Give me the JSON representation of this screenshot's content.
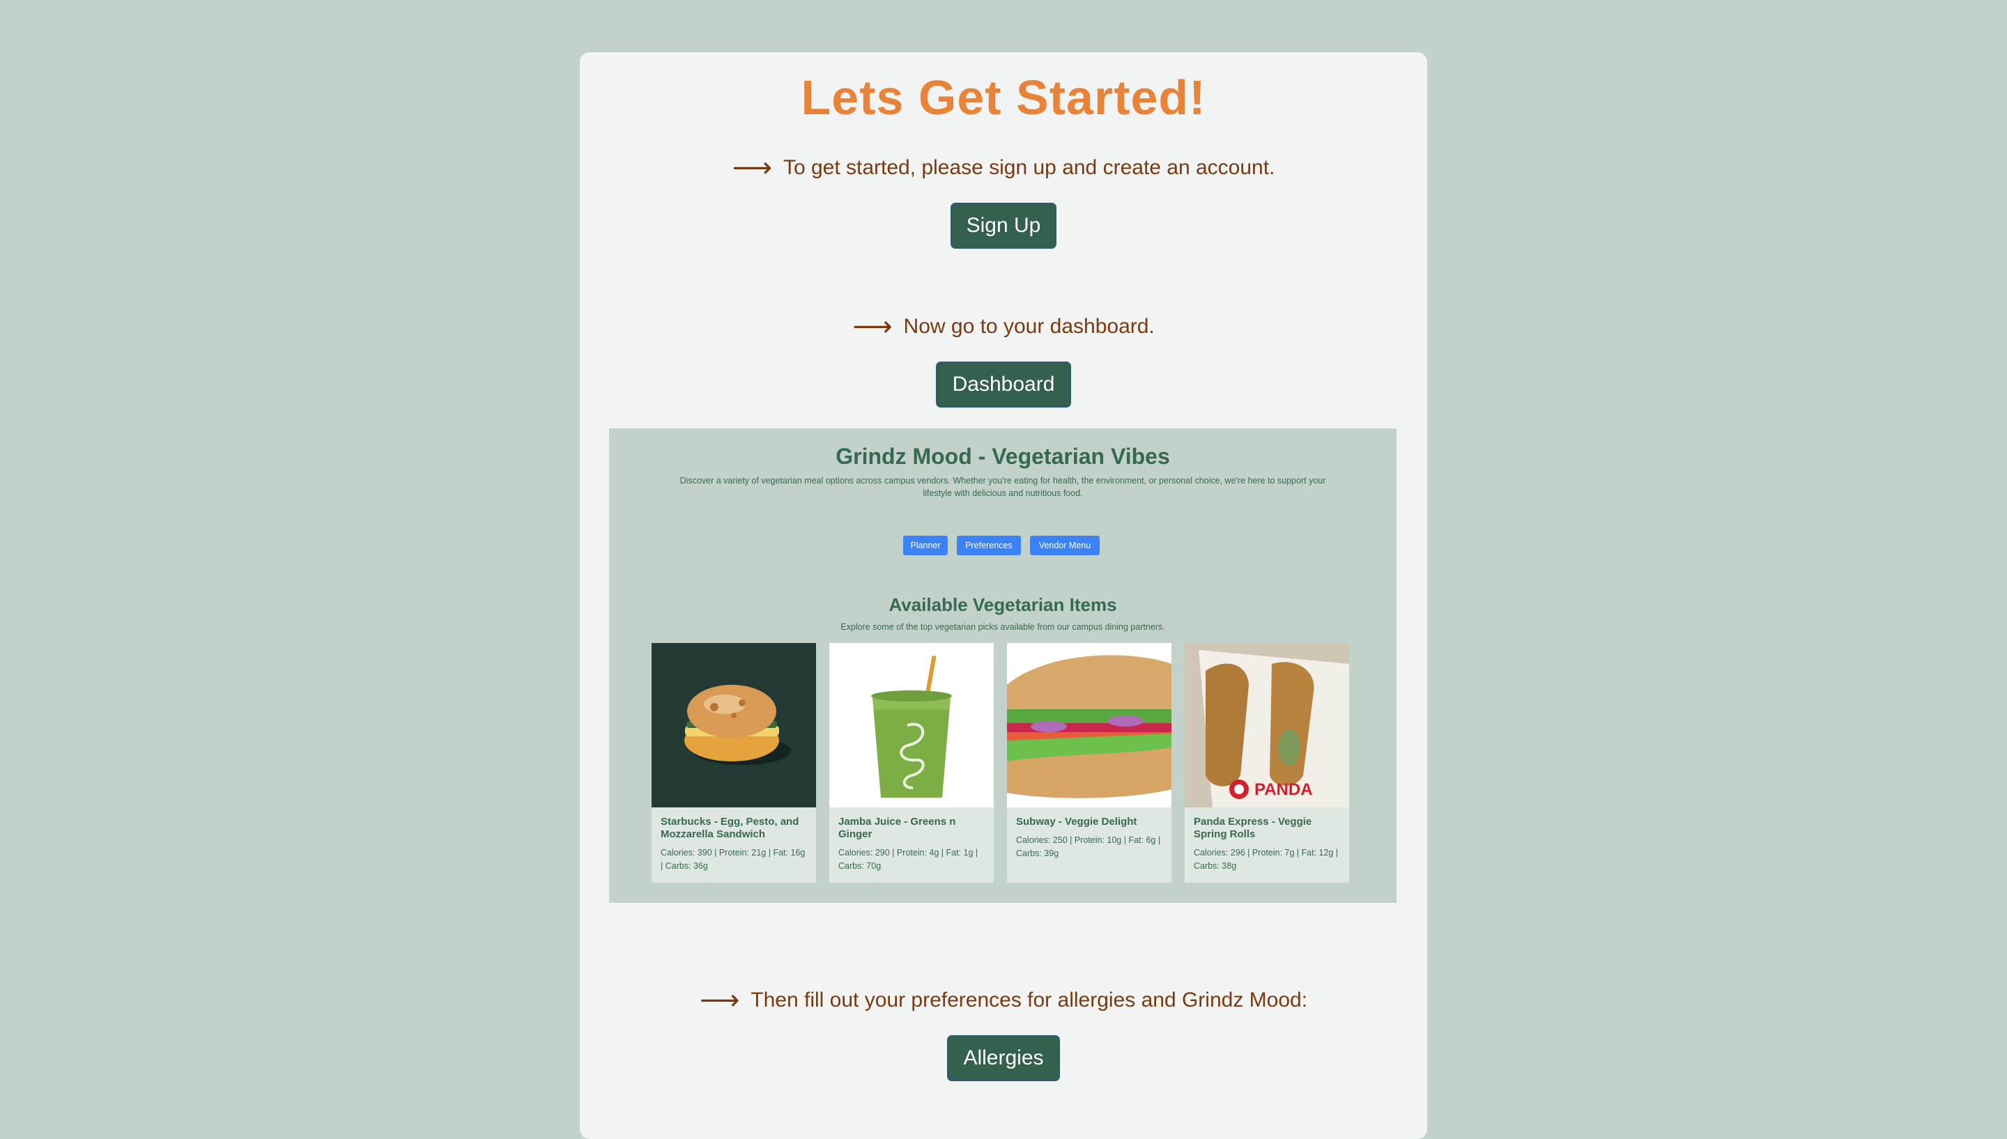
{
  "page": {
    "title": "Lets Get Started!",
    "arrow_glyph": "⟶"
  },
  "steps": [
    {
      "text": "To get started, please sign up and create an account.",
      "button": "Sign Up"
    },
    {
      "text": "Now go to your dashboard.",
      "button": "Dashboard"
    },
    {
      "text": "Then fill out your preferences for allergies and Grindz Mood:",
      "button": "Allergies"
    }
  ],
  "preview": {
    "title": "Grindz Mood - Vegetarian Vibes",
    "description": "Discover a variety of vegetarian meal options across campus vendors. Whether you're eating for health, the environment, or personal choice, we're here to support your lifestyle with delicious and nutritious food.",
    "nav": [
      "Planner",
      "Preferences",
      "Vendor Menu"
    ],
    "section_title": "Available Vegetarian Items",
    "section_desc": "Explore some of the top vegetarian picks available from our campus dining partners.",
    "items": [
      {
        "name": "Starbucks - Egg, Pesto, and Mozzarella Sandwich",
        "info": "Calories: 390 | Protein: 21g | Fat: 16g | Carbs: 36g"
      },
      {
        "name": "Jamba Juice - Greens n Ginger",
        "info": "Calories: 290 | Protein: 4g | Fat: 1g | Carbs: 70g"
      },
      {
        "name": "Subway - Veggie Delight",
        "info": "Calories: 250 | Protein: 10g | Fat: 6g | Carbs: 39g"
      },
      {
        "name": "Panda Express - Veggie Spring Rolls",
        "info": "Calories: 296 | Protein: 7g | Fat: 12g | Carbs: 38g"
      }
    ],
    "panda_logo_text": "PANDA"
  },
  "colors": {
    "background": "#c2d1ca",
    "card": "#f2f4f3",
    "title": "#e8843a",
    "step_text": "#7a3a10",
    "button": "#34614f",
    "preview_accent": "#356a50",
    "preview_button": "#3b82f6"
  }
}
